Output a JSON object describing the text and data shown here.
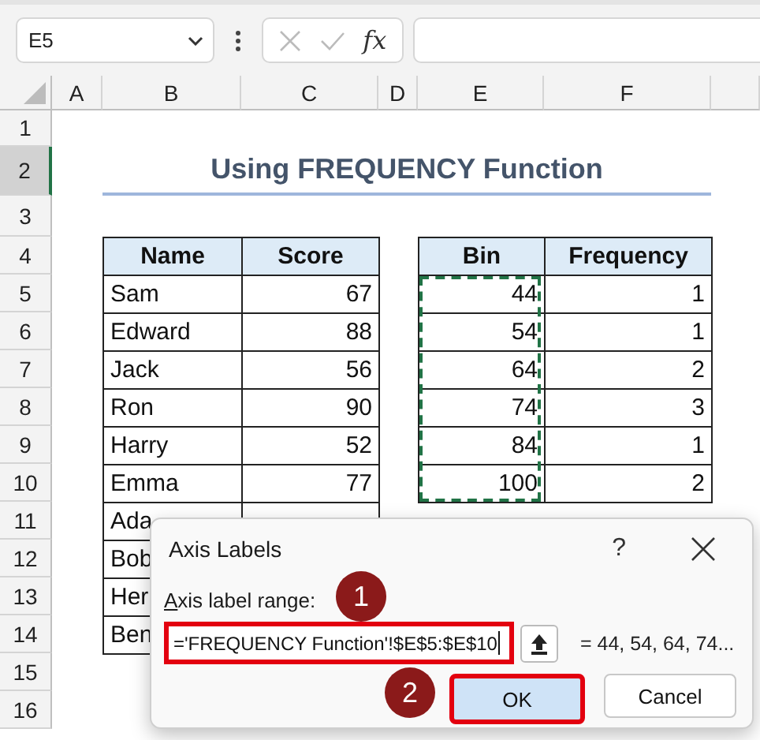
{
  "name_box": {
    "value": "E5"
  },
  "formula_bar": {
    "function_label": "fx"
  },
  "columns": [
    {
      "label": "A",
      "selected": false
    },
    {
      "label": "B",
      "selected": false
    },
    {
      "label": "C",
      "selected": false
    },
    {
      "label": "D",
      "selected": false
    },
    {
      "label": "E",
      "selected": false
    },
    {
      "label": "F",
      "selected": false
    }
  ],
  "rows": [
    {
      "label": "1",
      "selected": false
    },
    {
      "label": "2",
      "selected": true
    },
    {
      "label": "3",
      "selected": false
    },
    {
      "label": "4",
      "selected": false
    },
    {
      "label": "5",
      "selected": false
    },
    {
      "label": "6",
      "selected": false
    },
    {
      "label": "7",
      "selected": false
    },
    {
      "label": "8",
      "selected": false
    },
    {
      "label": "9",
      "selected": false
    },
    {
      "label": "10",
      "selected": false
    },
    {
      "label": "11",
      "selected": false
    },
    {
      "label": "12",
      "selected": false
    },
    {
      "label": "13",
      "selected": false
    },
    {
      "label": "14",
      "selected": false
    },
    {
      "label": "15",
      "selected": false
    },
    {
      "label": "16",
      "selected": false
    }
  ],
  "title": "Using FREQUENCY Function",
  "scores_table": {
    "columns": [
      "Name",
      "Score"
    ],
    "rows": [
      {
        "name": "Sam",
        "score": "67"
      },
      {
        "name": "Edward",
        "score": "88"
      },
      {
        "name": "Jack",
        "score": "56"
      },
      {
        "name": "Ron",
        "score": "90"
      },
      {
        "name": "Harry",
        "score": "52"
      },
      {
        "name": "Emma",
        "score": "77"
      },
      {
        "name": "Ada"
      },
      {
        "name": "Bob"
      },
      {
        "name": "Her"
      },
      {
        "name": "Ben"
      }
    ]
  },
  "bin_table": {
    "columns": [
      "Bin",
      "Frequency"
    ],
    "copy_marquee": true,
    "rows": [
      {
        "bin": "44",
        "frequency": "1"
      },
      {
        "bin": "54",
        "frequency": "1"
      },
      {
        "bin": "64",
        "frequency": "2"
      },
      {
        "bin": "74",
        "frequency": "3"
      },
      {
        "bin": "84",
        "frequency": "1"
      },
      {
        "bin": "100",
        "frequency": "2"
      }
    ]
  },
  "dialog": {
    "title": "Axis Labels",
    "help": "?",
    "field_label": "Axis label range:",
    "field_value": "='FREQUENCY Function'!$E$5:$E$10",
    "field_highlighted": true,
    "preview": "= 44, 54, 64, 74...",
    "buttons": [
      {
        "label": "OK",
        "default": true,
        "highlighted": true
      },
      {
        "label": "Cancel",
        "default": false,
        "highlighted": false
      }
    ],
    "annotations": [
      {
        "label": "1"
      },
      {
        "label": "2"
      }
    ]
  }
}
